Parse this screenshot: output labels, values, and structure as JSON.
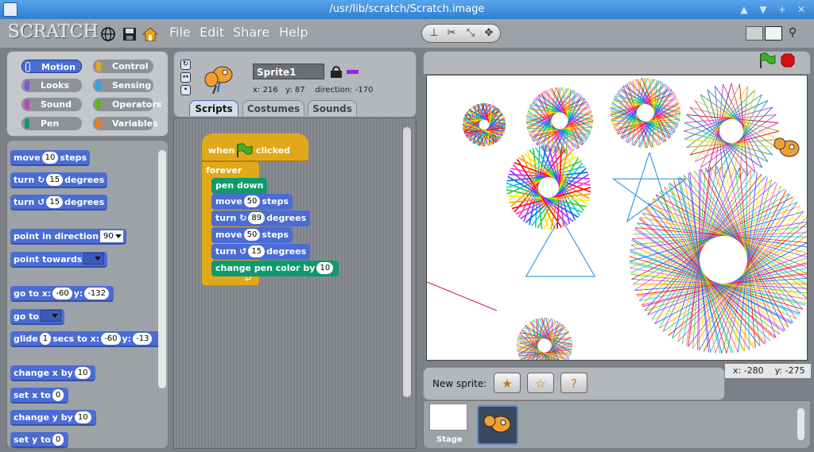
{
  "window": {
    "title": "/usr/lib/scratch/Scratch.image",
    "controls": [
      "▲",
      "▼",
      "+",
      "✕"
    ]
  },
  "menubar": {
    "logo": "SCRATCH",
    "menus": [
      "File",
      "Edit",
      "Share",
      "Help"
    ],
    "icons": [
      "globe-icon",
      "save-icon",
      "share-icon"
    ],
    "tools": [
      "stamp-icon",
      "scissors-icon",
      "grow-icon",
      "shrink-icon"
    ]
  },
  "categories": [
    {
      "label": "Motion",
      "color": "#4a6cd4",
      "selected": true
    },
    {
      "label": "Control",
      "color": "#e1a91a"
    },
    {
      "label": "Looks",
      "color": "#8a55d7"
    },
    {
      "label": "Sensing",
      "color": "#2ca5e2"
    },
    {
      "label": "Sound",
      "color": "#bb42c3"
    },
    {
      "label": "Operators",
      "color": "#5cb712"
    },
    {
      "label": "Pen",
      "color": "#0e9a6c"
    },
    {
      "label": "Variables",
      "color": "#ee7d16"
    }
  ],
  "palette": {
    "move": {
      "pre": "move",
      "val": "10",
      "post": "steps"
    },
    "turn_right": {
      "pre": "turn ↻",
      "val": "15",
      "post": "degrees"
    },
    "turn_left": {
      "pre": "turn ↺",
      "val": "15",
      "post": "degrees"
    },
    "point_direction": {
      "pre": "point in direction",
      "val": "90"
    },
    "point_towards": {
      "pre": "point towards"
    },
    "goto_xy": {
      "pre": "go to x:",
      "x": "-60",
      "mid": "y:",
      "y": "-132"
    },
    "goto": {
      "pre": "go to"
    },
    "glide": {
      "pre": "glide",
      "secs": "1",
      "mid": "secs to x:",
      "x": "-60",
      "mid2": "y:",
      "y": "-13"
    },
    "change_x": {
      "pre": "change x by",
      "val": "10"
    },
    "set_x": {
      "pre": "set x to",
      "val": "0"
    },
    "change_y": {
      "pre": "change y by",
      "val": "10"
    },
    "set_y": {
      "pre": "set y to",
      "val": "0"
    }
  },
  "sprite": {
    "name": "Sprite1",
    "x_label": "x:",
    "x": "216",
    "y_label": "y:",
    "y": "87",
    "direction_label": "direction:",
    "direction": "-170",
    "pen_color": "#a020f0"
  },
  "tabs": [
    {
      "label": "Scripts",
      "active": true
    },
    {
      "label": "Costumes"
    },
    {
      "label": "Sounds"
    }
  ],
  "script": {
    "hat": {
      "pre": "when",
      "post": "clicked"
    },
    "forever": "forever",
    "pen_down": "pen down",
    "move1": {
      "pre": "move",
      "val": "50",
      "post": "steps"
    },
    "turn1": {
      "pre": "turn ↻",
      "val": "89",
      "post": "degrees"
    },
    "move2": {
      "pre": "move",
      "val": "50",
      "post": "steps"
    },
    "turn2": {
      "pre": "turn ↺",
      "val": "15",
      "post": "degrees"
    },
    "change_color": {
      "pre": "change pen color by",
      "val": "10"
    }
  },
  "stage": {
    "mouse_x_label": "x:",
    "mouse_x": "-280",
    "mouse_y_label": "y:",
    "mouse_y": "-275"
  },
  "new_sprite": {
    "label": "New sprite:"
  },
  "sprite_list": {
    "stage_label": "Stage"
  },
  "colors": {
    "motion": "#4a6cd4",
    "control": "#e1a91a",
    "pen": "#0e9a6c"
  }
}
